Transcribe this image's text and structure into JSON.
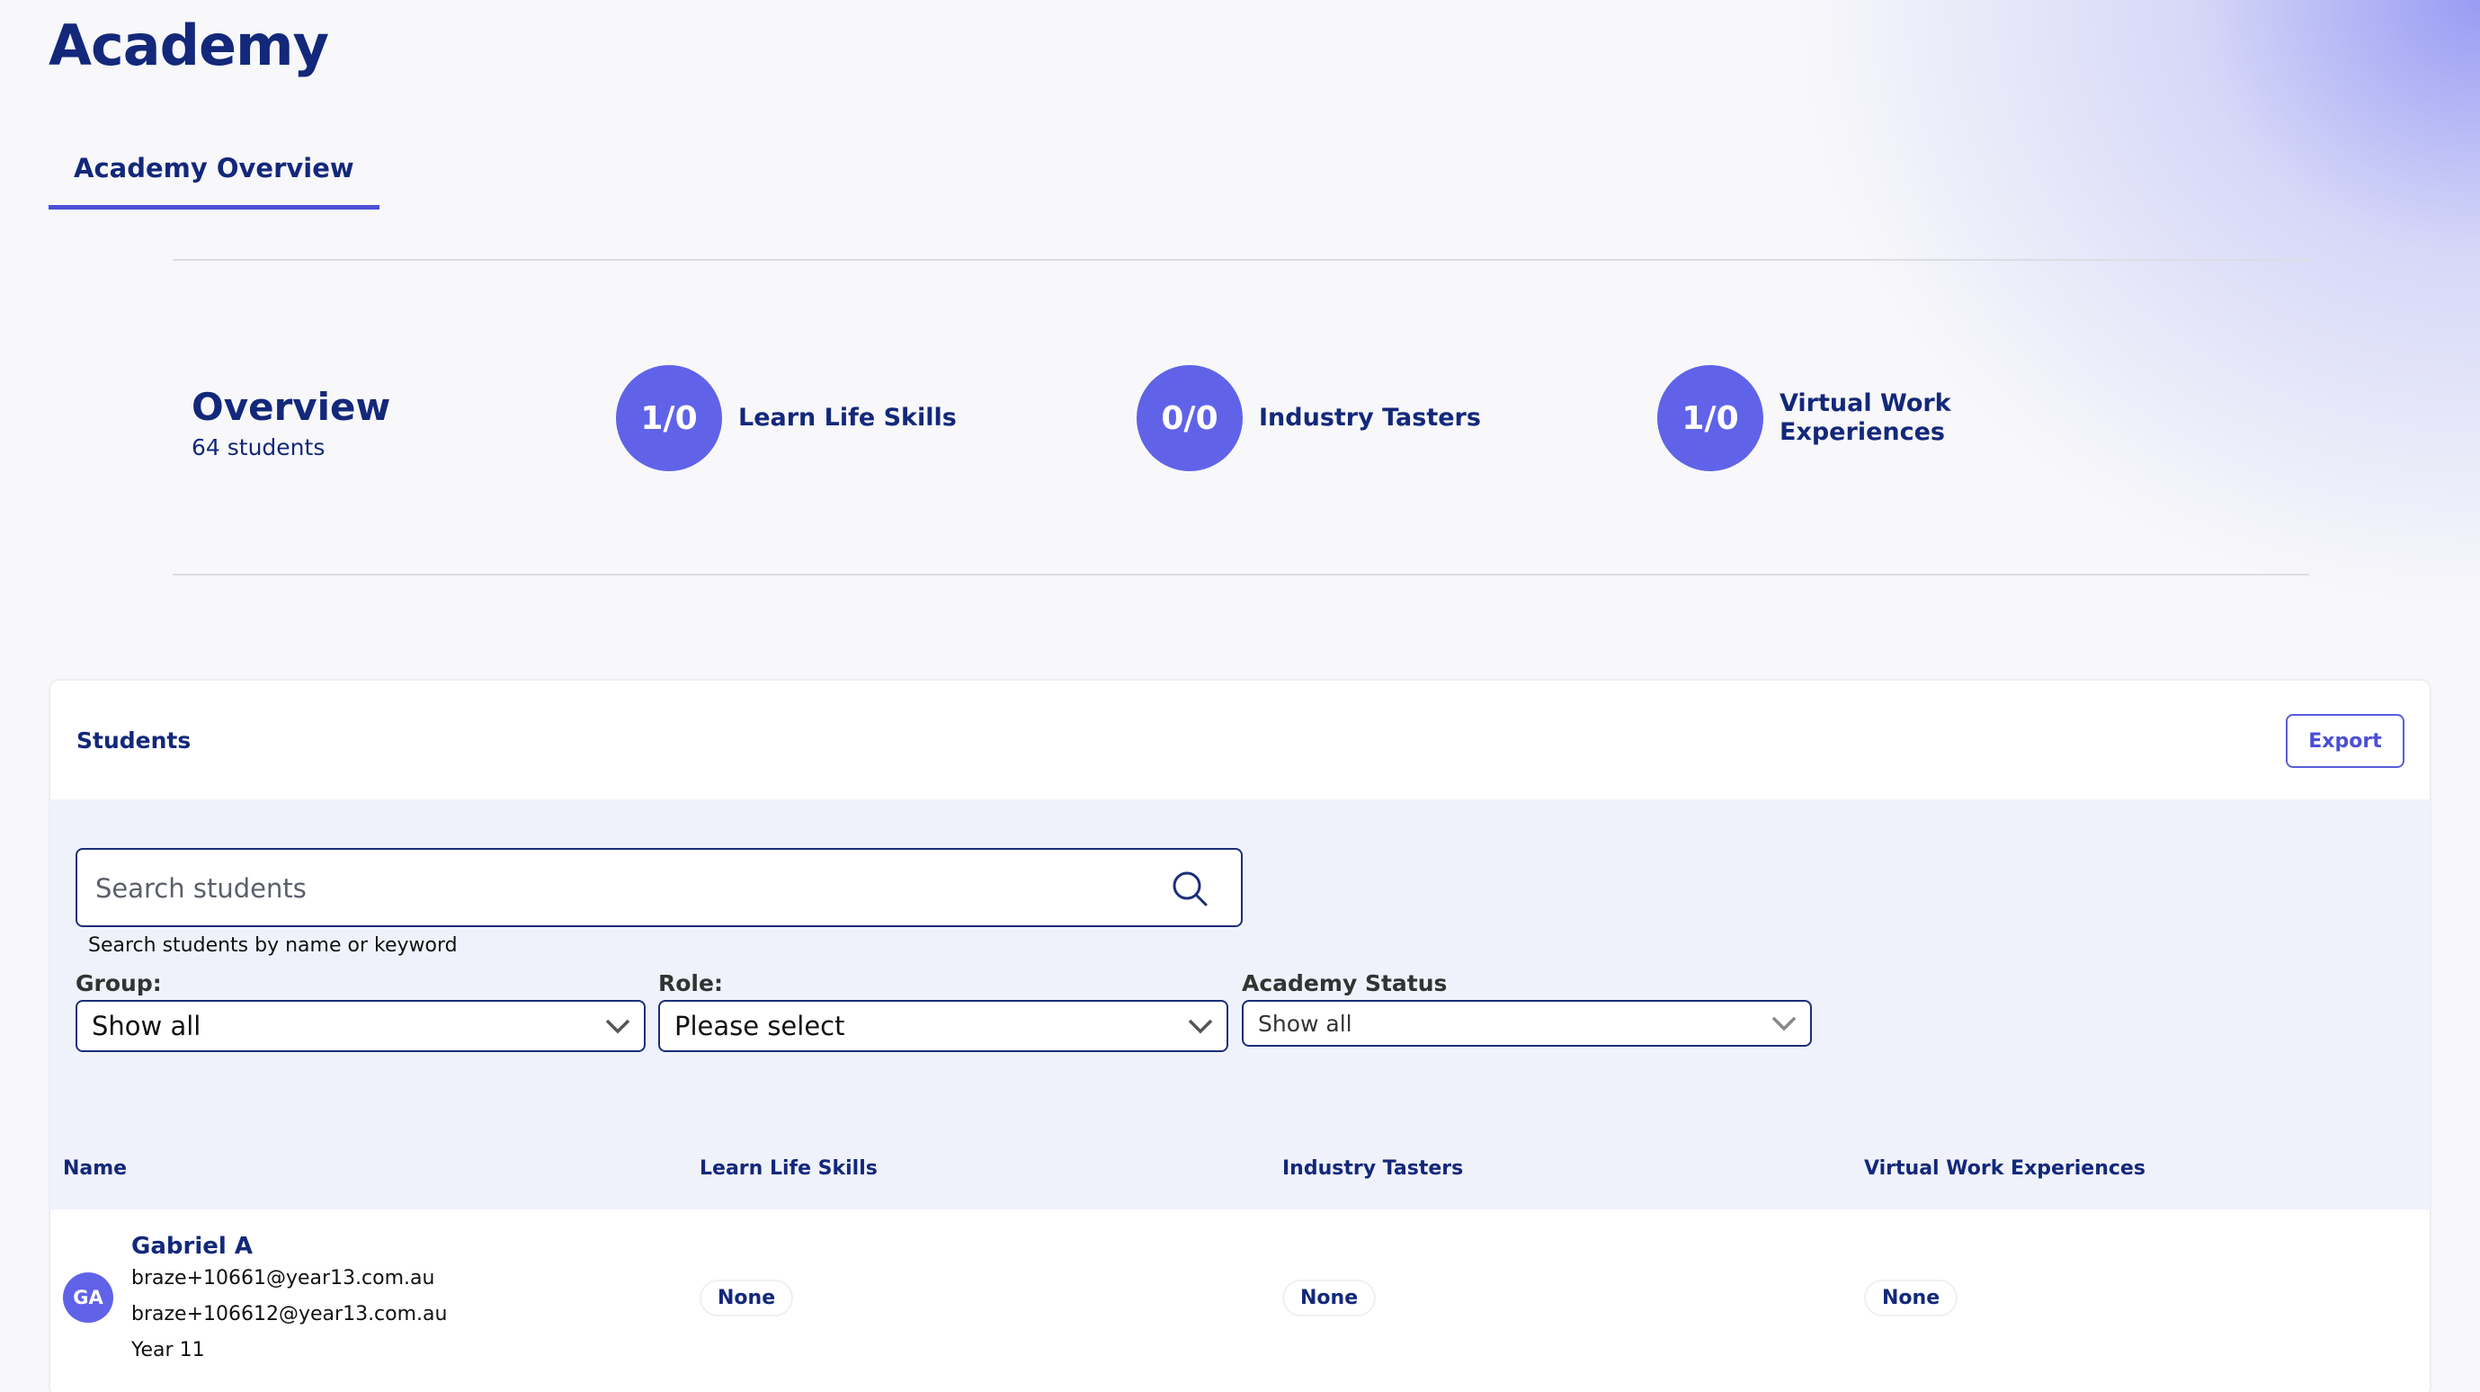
{
  "page": {
    "title": "Academy"
  },
  "tabs": [
    {
      "label": "Academy Overview"
    }
  ],
  "overview": {
    "title": "Overview",
    "subtitle": "64 students",
    "stats": [
      {
        "value": "1/0",
        "label": "Learn Life Skills"
      },
      {
        "value": "0/0",
        "label": "Industry Tasters"
      },
      {
        "value": "1/0",
        "label_line1": "Virtual Work",
        "label_line2": "Experiences"
      }
    ]
  },
  "students": {
    "title": "Students",
    "export_label": "Export",
    "search": {
      "placeholder": "Search students",
      "help": "Search students by name or keyword",
      "icon": "search-icon"
    },
    "filters": [
      {
        "label": "Group:",
        "value": "Show all"
      },
      {
        "label": "Role:",
        "value": "Please select"
      },
      {
        "label": "Academy Status",
        "value": "Show all"
      }
    ],
    "columns": [
      "Name",
      "Learn Life Skills",
      "Industry Tasters",
      "Virtual Work Experiences"
    ],
    "rows": [
      {
        "initials": "GA",
        "name": "Gabriel A",
        "email1": "braze+10661@year13.com.au",
        "email2": "braze+106612@year13.com.au",
        "year": "Year 11",
        "learn_life_skills": "None",
        "industry_tasters": "None",
        "virtual_work_experiences": "None"
      }
    ]
  },
  "colors": {
    "accent": "#6063e8",
    "navy": "#13287a",
    "filter_bg": "#eff2fa"
  }
}
